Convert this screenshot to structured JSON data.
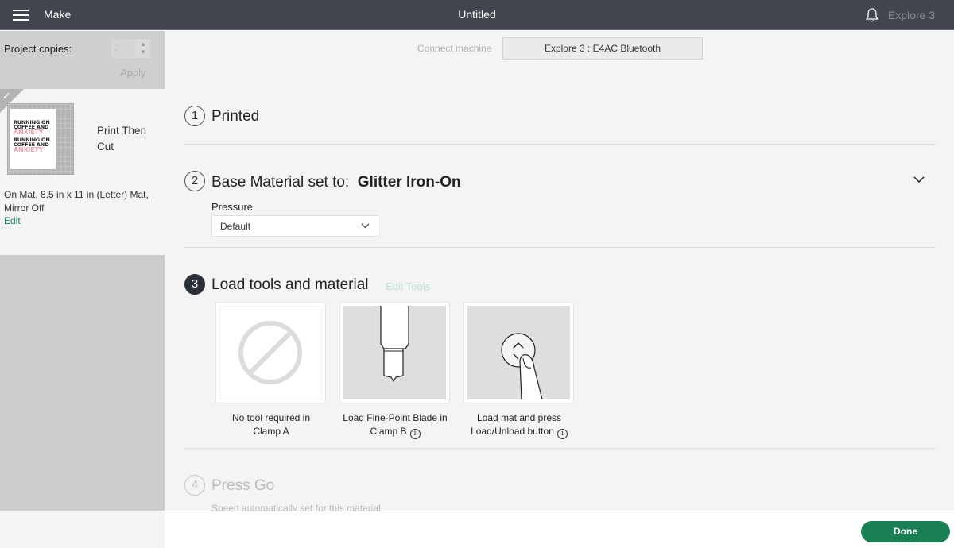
{
  "topbar": {
    "menu_icon": "hamburger-menu-icon",
    "app_title": "Make",
    "document_title": "Untitled",
    "notification_icon": "bell-icon",
    "machine_name": "Explore 3"
  },
  "left_panel": {
    "copies_label": "Project copies:",
    "copies_value": "2",
    "apply_label": "Apply",
    "mat": {
      "selected": true,
      "title": "Print Then Cut",
      "thumbnail_lines": [
        "RUNNING ON",
        "COFFEE AND",
        "ANXIETY",
        "RUNNING ON",
        "COFFEE AND",
        "ANXIETY"
      ],
      "info": "On Mat, 8.5 in x 11 in (Letter) Mat, Mirror Off",
      "edit_label": "Edit"
    }
  },
  "main": {
    "connect_label": "Connect machine",
    "connect_button": "Explore 3 : E4AC Bluetooth",
    "steps": [
      {
        "number": "1",
        "title": "Printed"
      },
      {
        "number": "2",
        "title_prefix": "Base Material set to:",
        "material": "Glitter Iron-On",
        "pressure_label": "Pressure",
        "pressure_value": "Default"
      },
      {
        "number": "3",
        "title": "Load tools and material",
        "edit_tools_label": "Edit Tools",
        "tools": [
          {
            "icon": "no-tool-icon",
            "line1": "No tool required in",
            "line2": "Clamp A",
            "info": false
          },
          {
            "icon": "fine-point-blade-icon",
            "line1": "Load Fine-Point Blade in",
            "line2": "Clamp B",
            "info": true
          },
          {
            "icon": "load-unload-button-icon",
            "line1": "Load mat and press",
            "line2": "Load/Unload button",
            "info": true
          }
        ]
      },
      {
        "number": "4",
        "title": "Press Go",
        "subtitle": "Speed automatically set for this material"
      }
    ]
  },
  "footer": {
    "done_label": "Done"
  },
  "colors": {
    "topbar": "#41464e",
    "accent_green": "#1a7f54",
    "link_green": "#1a8a5a",
    "edit_tools_disabled": "#bde3d2"
  }
}
